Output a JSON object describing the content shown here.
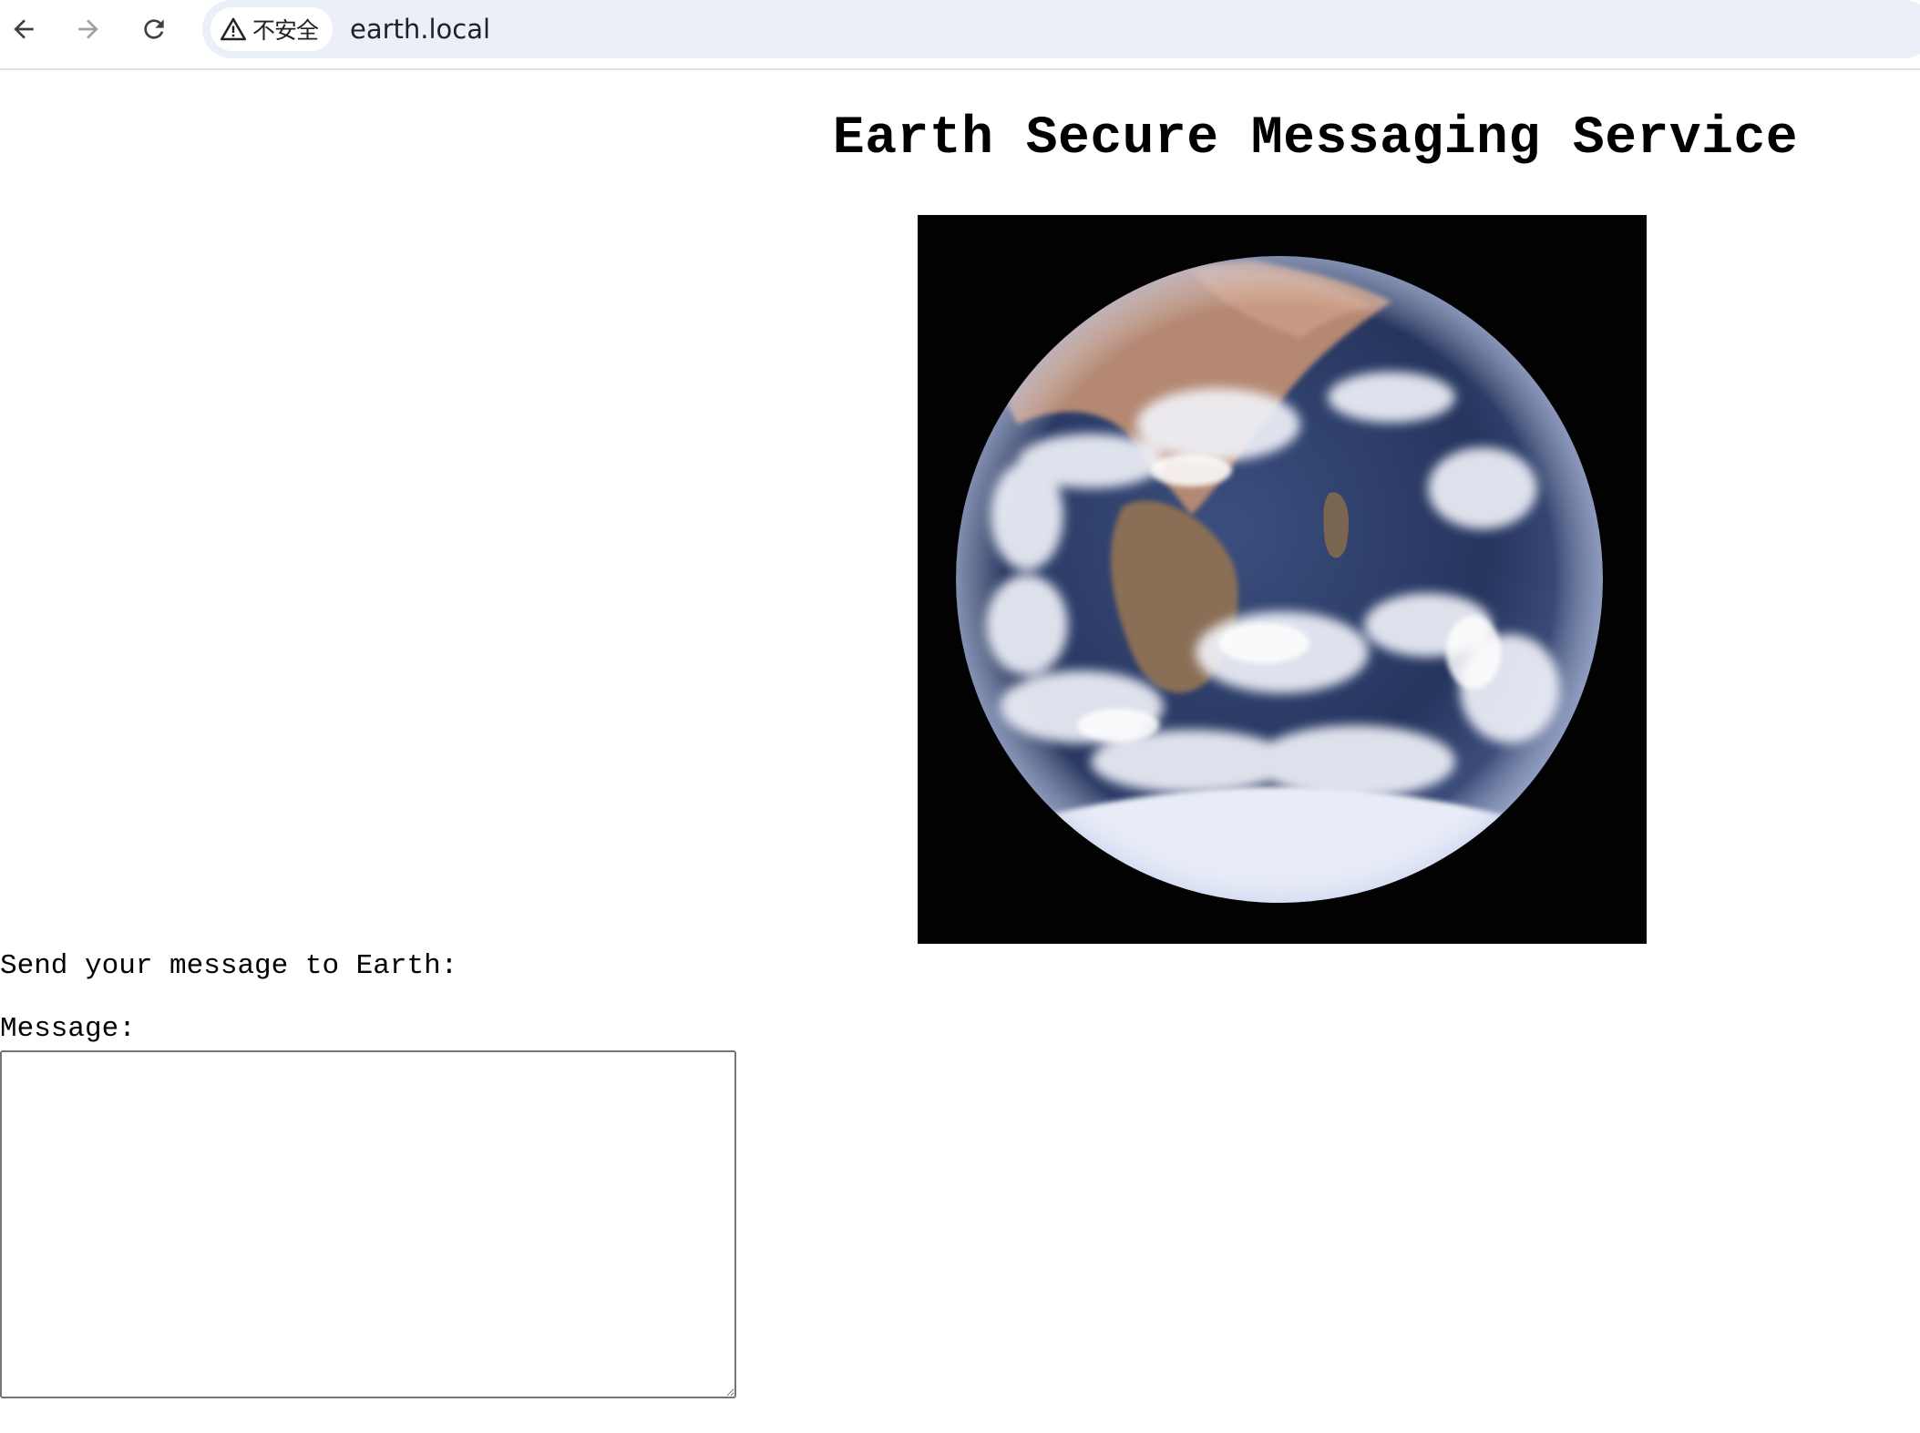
{
  "browser": {
    "security_label": "不安全",
    "url": "earth.local",
    "icons": {
      "back": "arrow-left-icon",
      "forward": "arrow-right-icon",
      "reload": "reload-icon",
      "security": "warning-triangle-icon"
    },
    "colors": {
      "omnibox_bg": "#ebf0f8",
      "forward_disabled": "#9aa0a6",
      "icon": "#3c4043"
    }
  },
  "page": {
    "title": "Earth Secure Messaging Service",
    "prompt": "Send your message to Earth:",
    "message_label": "Message:",
    "message_value": ""
  }
}
